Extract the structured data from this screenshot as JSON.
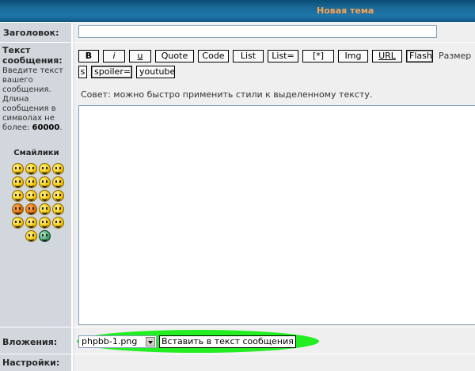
{
  "header": {
    "title": "Новая тема"
  },
  "subject": {
    "label": "Заголовок:",
    "value": ""
  },
  "message": {
    "label_line1": "Текст",
    "label_line2": "сообщения:",
    "hint": "Введите текст вашего сообщения. Длина сообщения в символах не более:",
    "max_chars": "60000",
    "tip": "Совет: можно быстро применить стили к выделенному тексту.",
    "value": ""
  },
  "smilies": {
    "title": "Смайлики"
  },
  "toolbar": {
    "row1": [
      "B",
      "i",
      "u",
      "Quote",
      "Code",
      "List",
      "List=",
      "[*]",
      "Img",
      "URL",
      "Flash"
    ],
    "size_label": "Размер",
    "row2": [
      "s",
      "spoiler=",
      "youtube"
    ]
  },
  "attachments": {
    "label": "Вложения:",
    "selected_file": "phpbb-1.png",
    "insert_button": "Вставить в текст сообщения",
    "highlight_color": "#22ee22"
  },
  "settings": {
    "label": "Настройки:"
  }
}
